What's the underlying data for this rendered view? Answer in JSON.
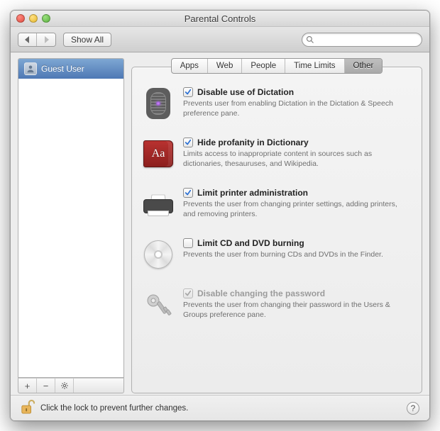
{
  "window": {
    "title": "Parental Controls"
  },
  "toolbar": {
    "show_all_label": "Show All",
    "search_placeholder": ""
  },
  "sidebar": {
    "users": [
      {
        "label": "Guest User"
      }
    ],
    "buttons": {
      "add": "+",
      "remove": "−",
      "settings": ""
    }
  },
  "tabs": [
    {
      "label": "Apps",
      "selected": false
    },
    {
      "label": "Web",
      "selected": false
    },
    {
      "label": "People",
      "selected": false
    },
    {
      "label": "Time Limits",
      "selected": false
    },
    {
      "label": "Other",
      "selected": true
    }
  ],
  "options": [
    {
      "key": "dictation",
      "icon": "microphone-icon",
      "checked": true,
      "enabled": true,
      "title": "Disable use of Dictation",
      "desc": "Prevents user from enabling Dictation in the Dictation & Speech preference pane."
    },
    {
      "key": "profanity",
      "icon": "dictionary-icon",
      "checked": true,
      "enabled": true,
      "title": "Hide profanity in Dictionary",
      "desc": "Limits access to inappropriate content in sources such as dictionaries, thesauruses, and Wikipedia."
    },
    {
      "key": "printer",
      "icon": "printer-icon",
      "checked": true,
      "enabled": true,
      "title": "Limit printer administration",
      "desc": "Prevents the user from changing printer settings, adding printers, and removing printers."
    },
    {
      "key": "burning",
      "icon": "disc-icon",
      "checked": false,
      "enabled": true,
      "title": "Limit CD and DVD burning",
      "desc": "Prevents the user from burning CDs and DVDs in the Finder."
    },
    {
      "key": "password",
      "icon": "key-icon",
      "checked": true,
      "enabled": false,
      "title": "Disable changing the password",
      "desc": "Prevents the user from changing their password in the Users & Groups preference pane."
    }
  ],
  "footer": {
    "lock_message": "Click the lock to prevent further changes.",
    "help_label": "?"
  }
}
